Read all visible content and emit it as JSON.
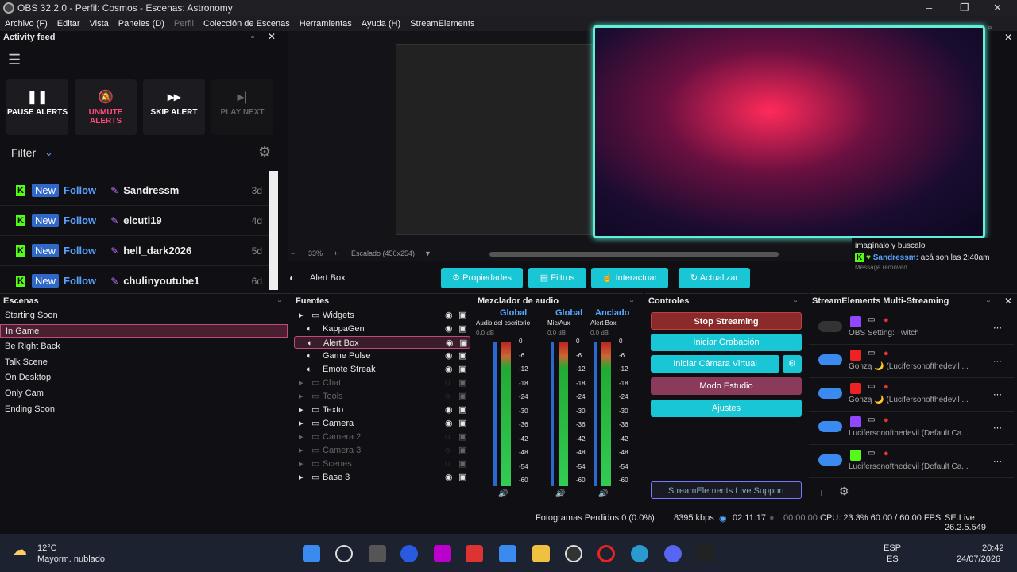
{
  "window": {
    "title": "OBS 32.2.0 - Perfil: Cosmos - Escenas: Astronomy"
  },
  "menu": [
    "Archivo (F)",
    "Editar",
    "Vista",
    "Paneles (D)",
    "Perfil",
    "Colección de Escenas",
    "Herramientas",
    "Ayuda (H)",
    "StreamElements"
  ],
  "feed": {
    "title": "Activity feed",
    "buttons": [
      {
        "label": "PAUSE ALERTS",
        "icon": "pause-icon"
      },
      {
        "label": "UNMUTE ALERTS",
        "icon": "bell-mute-icon"
      },
      {
        "label": "SKIP ALERT",
        "icon": "forward-icon"
      },
      {
        "label": "PLAY NEXT",
        "icon": "next-icon"
      }
    ],
    "filter": "Filter",
    "events": [
      {
        "badge": "New",
        "type": "Follow",
        "name": "Sandressm",
        "age": "3d"
      },
      {
        "badge": "New",
        "type": "Follow",
        "name": "elcuti19",
        "age": "4d"
      },
      {
        "badge": "New",
        "type": "Follow",
        "name": "hell_dark2026",
        "age": "5d"
      },
      {
        "badge": "New",
        "type": "Follow",
        "name": "chulinyoutube1",
        "age": "6d"
      }
    ]
  },
  "preview": {
    "zoom": "33%",
    "scale": "Escalado (450x254)"
  },
  "source_toolbar": {
    "name": "Alert Box",
    "buttons": [
      "Propiedades",
      "Filtros",
      "Interactuar",
      "Actualizar"
    ]
  },
  "chat": {
    "line1": "imagínalo y buscalo",
    "user": "Sandressm:",
    "msg": "acá son las 2:40am",
    "removed": "Message removed"
  },
  "scenes": {
    "title": "Escenas",
    "items": [
      "Starting Soon",
      "In Game",
      "Be Right Back",
      "Talk Scene",
      "On Desktop",
      "Only Cam",
      "Ending Soon"
    ],
    "selected": "In Game"
  },
  "sources": {
    "title": "Fuentes",
    "items": [
      {
        "name": "Widgets",
        "group": true,
        "dim": false
      },
      {
        "name": "KappaGen",
        "group": false,
        "dim": false
      },
      {
        "name": "Alert Box",
        "group": false,
        "dim": false
      },
      {
        "name": "Game Pulse",
        "group": false,
        "dim": false
      },
      {
        "name": "Emote Streak",
        "group": false,
        "dim": false
      },
      {
        "name": "Chat",
        "group": true,
        "dim": true
      },
      {
        "name": "Tools",
        "group": true,
        "dim": true
      },
      {
        "name": "Texto",
        "group": true,
        "dim": false
      },
      {
        "name": "Camera",
        "group": true,
        "dim": false
      },
      {
        "name": "Camera 2",
        "group": true,
        "dim": true
      },
      {
        "name": "Camera 3",
        "group": true,
        "dim": true
      },
      {
        "name": "Scenes",
        "group": true,
        "dim": true
      },
      {
        "name": "Base 3",
        "group": true,
        "dim": false
      }
    ]
  },
  "mixer": {
    "title": "Mezclador de audio",
    "channels": [
      {
        "tag": "Global",
        "name": "Audio del escritorio",
        "db": "0.0 dB"
      },
      {
        "tag": "Global",
        "name": "Mic/Aux",
        "db": "0.0 dB"
      },
      {
        "tag": "Anclado",
        "name": "Alert Box",
        "db": "0.0 dB"
      }
    ],
    "ticks": [
      "0",
      "-6",
      "-12",
      "-18",
      "-24",
      "-30",
      "-36",
      "-42",
      "-48",
      "-54",
      "-60"
    ]
  },
  "controls": {
    "title": "Controles",
    "buttons": [
      "Stop Streaming",
      "Iniciar Grabación",
      "Iniciar Cámara Virtual",
      "Modo Estudio",
      "Ajustes"
    ],
    "support": "StreamElements Live Support"
  },
  "multistream": {
    "title": "StreamElements Multi-Streaming",
    "rows": [
      {
        "platform": "Twitch",
        "label": "OBS Setting: Twitch",
        "on": false
      },
      {
        "platform": "YouTube",
        "label": "Gonzą 🌙 (Lucifersonofthedevil ...",
        "on": true
      },
      {
        "platform": "YouTube",
        "label": "Gonzą 🌙 (Lucifersonofthedevil ...",
        "on": true
      },
      {
        "platform": "Twitch",
        "label": "Lucifersonofthedevil (Default Ca...",
        "on": true
      },
      {
        "platform": "Kick",
        "label": "Lucifersonofthedevil (Default Ca...",
        "on": true
      }
    ]
  },
  "status": {
    "dropped": "Fotogramas Perdidos 0 (0.0%)",
    "bitrate": "8395 kbps",
    "stream_time": "02:11:17",
    "rec_time": "00:00:00",
    "cpu": "CPU: 23.3% 60.00 / 60.00 FPS",
    "version": "SE.Live 26.2.5.549"
  },
  "taskbar": {
    "temp": "12°C",
    "weather": "Mayorm. nublado",
    "lang": "ESP",
    "lang2": "ES",
    "time": "20:42",
    "date": "24/07/2026"
  }
}
